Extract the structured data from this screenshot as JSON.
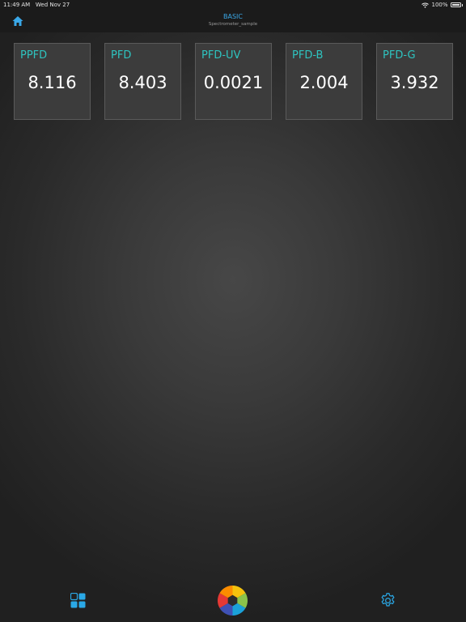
{
  "status_bar": {
    "time": "11:49 AM",
    "date": "Wed Nov 27",
    "battery": "100%"
  },
  "nav": {
    "title": "BASIC",
    "subtitle": "Spectrometer_sample",
    "home_icon": "home-icon"
  },
  "tiles": [
    {
      "label": "PPFD",
      "value": "8.116"
    },
    {
      "label": "PFD",
      "value": "8.403"
    },
    {
      "label": "PFD-UV",
      "value": "0.0021"
    },
    {
      "label": "PFD-B",
      "value": "2.004"
    },
    {
      "label": "PFD-G",
      "value": "3.932"
    }
  ],
  "bottom_bar": {
    "left_icon": "grid-icon",
    "center_icon": "aperture-icon",
    "right_icon": "gear-icon"
  },
  "colors": {
    "accent_blue": "#3aa8e8",
    "tile_label": "#2ec4c0",
    "tile_bg": "#3c3c3c"
  }
}
